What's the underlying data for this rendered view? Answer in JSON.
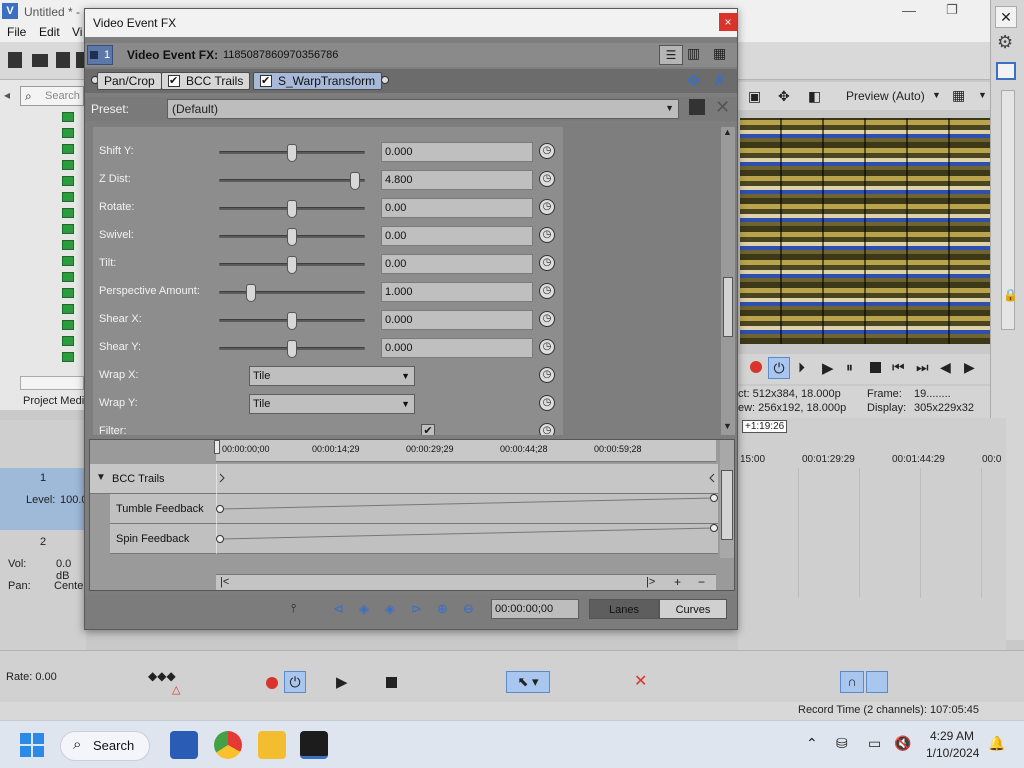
{
  "app": {
    "window_title": "Untitled * -",
    "menu": [
      "File",
      "Edit",
      "Vi"
    ],
    "explorer_search_placeholder": "Search",
    "explorer_tab": "Project Medi"
  },
  "preview": {
    "mode": "Preview (Auto)",
    "info": {
      "row1_left": "ct:  512x384, 18.000p",
      "row1_right_label": "Frame:",
      "row1_right_value": "19........",
      "row2_left": "ew:  256x192, 18.000p",
      "row2_right_label": "Display:",
      "row2_right_value": "305x229x32"
    }
  },
  "timeline": {
    "position_badge": "+1:19:26",
    "ruler": [
      "15:00",
      "00:01:29:29",
      "00:01:44:29",
      "00:0"
    ],
    "tracks": [
      {
        "number": "1",
        "label": "Level:",
        "value": "100.0"
      },
      {
        "number": "2",
        "vol_label": "Vol:",
        "vol_value": "0.0 dB",
        "pan_label": "Pan:",
        "pan_value": "Cente"
      }
    ],
    "rate": "Rate: 0.00",
    "record_time": "Record Time (2 channels): 107:05:45"
  },
  "fx": {
    "title": "Video Event FX",
    "close_glyph": "×",
    "event_label": "Video Event FX:",
    "event_id": "1185087860970356786",
    "track_number": "1",
    "chain": [
      {
        "label": "Pan/Crop",
        "checked": false,
        "active": false
      },
      {
        "label": "BCC Trails",
        "checked": true,
        "active": false
      },
      {
        "label": "S_WarpTransform",
        "checked": true,
        "active": true
      }
    ],
    "preset_label": "Preset:",
    "preset_value": "(Default)",
    "params": [
      {
        "label": "Shift Y:",
        "type": "slider",
        "value": "0.000",
        "pos": 0.5
      },
      {
        "label": "Z Dist:",
        "type": "slider",
        "value": "4.800",
        "pos": 0.96
      },
      {
        "label": "Rotate:",
        "type": "slider",
        "value": "0.00",
        "pos": 0.5
      },
      {
        "label": "Swivel:",
        "type": "slider",
        "value": "0.00",
        "pos": 0.5
      },
      {
        "label": "Tilt:",
        "type": "slider",
        "value": "0.00",
        "pos": 0.5
      },
      {
        "label": "Perspective Amount:",
        "type": "slider",
        "value": "1.000",
        "pos": 0.2
      },
      {
        "label": "Shear X:",
        "type": "slider",
        "value": "0.000",
        "pos": 0.5
      },
      {
        "label": "Shear Y:",
        "type": "slider",
        "value": "0.000",
        "pos": 0.5
      },
      {
        "label": "Wrap X:",
        "type": "select",
        "value": "Tile"
      },
      {
        "label": "Wrap Y:",
        "type": "select",
        "value": "Tile"
      },
      {
        "label": "Filter:",
        "type": "check",
        "value": "✔"
      }
    ],
    "keyframes": {
      "ruler": [
        "00:00:00;00",
        "00:00:14;29",
        "00:00:29;29",
        "00:00:44;28",
        "00:00:59;28"
      ],
      "group": "BCC Trails",
      "rows": [
        "Tumble Feedback",
        "Spin Feedback"
      ]
    },
    "footer": {
      "time": "00:00:00;00",
      "tabs": [
        "Lanes",
        "Curves"
      ]
    }
  },
  "taskbar": {
    "search_label": "Search",
    "time": "4:29 AM",
    "date": "1/10/2024"
  },
  "colors": {
    "accent_blue": "#a8b8d8",
    "record_red": "#d9342b",
    "keyframe_green": "#2e9a3e"
  }
}
